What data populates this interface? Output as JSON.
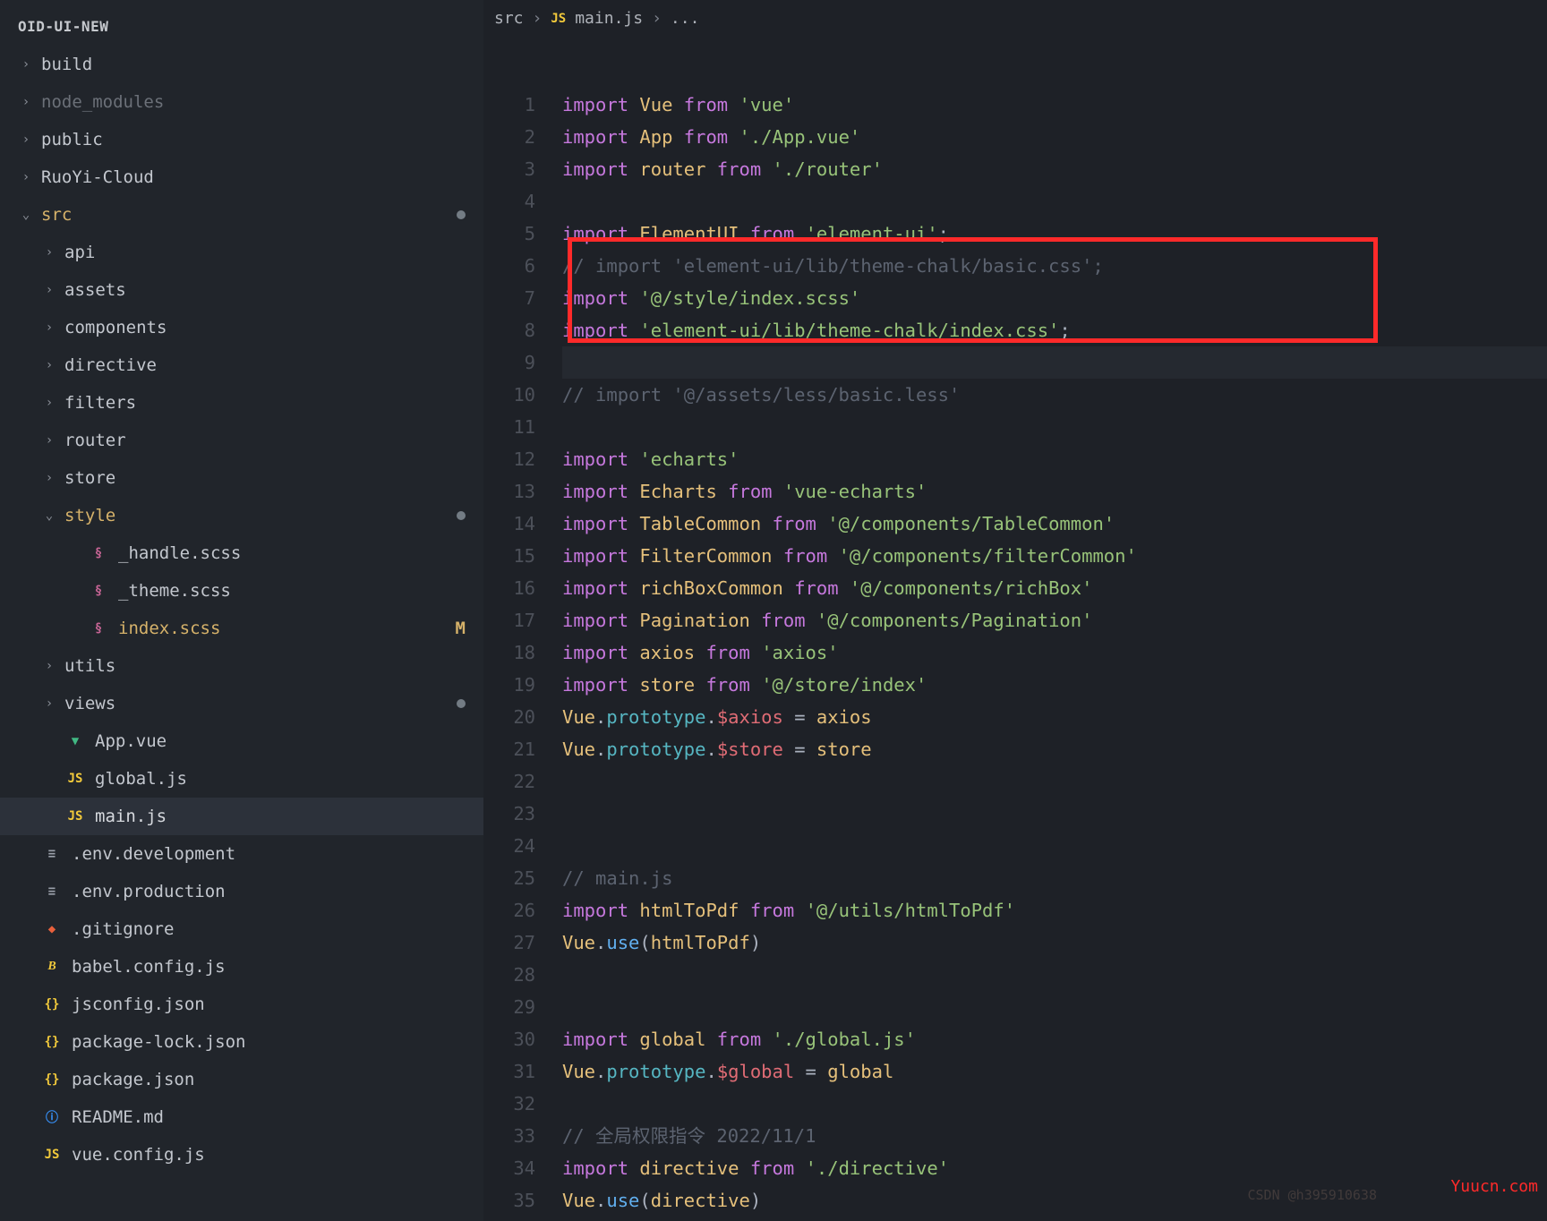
{
  "sidebar": {
    "title": "OID-UI-NEW",
    "items": [
      {
        "label": "build",
        "depth": 1,
        "chev": ">",
        "cls": ""
      },
      {
        "label": "node_modules",
        "depth": 1,
        "chev": ">",
        "cls": "",
        "dim": true
      },
      {
        "label": "public",
        "depth": 1,
        "chev": ">",
        "cls": ""
      },
      {
        "label": "RuoYi-Cloud",
        "depth": 1,
        "chev": ">",
        "cls": ""
      },
      {
        "label": "src",
        "depth": 1,
        "chev": "v",
        "cls": "expanded folder-src",
        "dot": true
      },
      {
        "label": "api",
        "depth": 2,
        "chev": ">",
        "cls": ""
      },
      {
        "label": "assets",
        "depth": 2,
        "chev": ">",
        "cls": ""
      },
      {
        "label": "components",
        "depth": 2,
        "chev": ">",
        "cls": ""
      },
      {
        "label": "directive",
        "depth": 2,
        "chev": ">",
        "cls": ""
      },
      {
        "label": "filters",
        "depth": 2,
        "chev": ">",
        "cls": ""
      },
      {
        "label": "router",
        "depth": 2,
        "chev": ">",
        "cls": ""
      },
      {
        "label": "store",
        "depth": 2,
        "chev": ">",
        "cls": ""
      },
      {
        "label": "style",
        "depth": 2,
        "chev": "v",
        "cls": "style-hl",
        "dot": true
      },
      {
        "label": "_handle.scss",
        "depth": 3,
        "chev": "",
        "cls": "",
        "ico": "scss"
      },
      {
        "label": "_theme.scss",
        "depth": 3,
        "chev": "",
        "cls": "",
        "ico": "scss"
      },
      {
        "label": "index.scss",
        "depth": 3,
        "chev": "",
        "cls": "style-sub",
        "ico": "scss",
        "badge": "M"
      },
      {
        "label": "utils",
        "depth": 2,
        "chev": ">",
        "cls": ""
      },
      {
        "label": "views",
        "depth": 2,
        "chev": ">",
        "cls": "",
        "dot": true
      },
      {
        "label": "App.vue",
        "depth": 2,
        "chev": "",
        "cls": "",
        "ico": "vue"
      },
      {
        "label": "global.js",
        "depth": 2,
        "chev": "",
        "cls": "",
        "ico": "js"
      },
      {
        "label": "main.js",
        "depth": 2,
        "chev": "",
        "cls": "selected",
        "ico": "js"
      },
      {
        "label": ".env.development",
        "depth": 1,
        "chev": "",
        "cls": "",
        "ico": "env"
      },
      {
        "label": ".env.production",
        "depth": 1,
        "chev": "",
        "cls": "",
        "ico": "env"
      },
      {
        "label": ".gitignore",
        "depth": 1,
        "chev": "",
        "cls": "",
        "ico": "git"
      },
      {
        "label": "babel.config.js",
        "depth": 1,
        "chev": "",
        "cls": "",
        "ico": "babel"
      },
      {
        "label": "jsconfig.json",
        "depth": 1,
        "chev": "",
        "cls": "",
        "ico": "json"
      },
      {
        "label": "package-lock.json",
        "depth": 1,
        "chev": "",
        "cls": "",
        "ico": "json"
      },
      {
        "label": "package.json",
        "depth": 1,
        "chev": "",
        "cls": "",
        "ico": "json"
      },
      {
        "label": "README.md",
        "depth": 1,
        "chev": "",
        "cls": "",
        "ico": "info"
      },
      {
        "label": "vue.config.js",
        "depth": 1,
        "chev": "",
        "cls": "",
        "ico": "js"
      }
    ]
  },
  "breadcrumb": {
    "seg1": "src",
    "seg2": "main.js",
    "seg3": "..."
  },
  "code": {
    "lines": [
      {
        "n": 1,
        "tokens": [
          [
            "kw-import",
            "import "
          ],
          [
            "ident-b",
            "Vue"
          ],
          [
            "kw-from",
            " from "
          ],
          [
            "str",
            "'vue'"
          ]
        ]
      },
      {
        "n": 2,
        "tokens": [
          [
            "kw-import",
            "import "
          ],
          [
            "ident-b",
            "App"
          ],
          [
            "kw-from",
            " from "
          ],
          [
            "str",
            "'./App.vue'"
          ]
        ]
      },
      {
        "n": 3,
        "tokens": [
          [
            "kw-import",
            "import "
          ],
          [
            "ident-b",
            "router"
          ],
          [
            "kw-from",
            " from "
          ],
          [
            "str",
            "'./router'"
          ]
        ]
      },
      {
        "n": 4,
        "tokens": []
      },
      {
        "n": 5,
        "tokens": [
          [
            "kw-import",
            "import "
          ],
          [
            "ident-b",
            "ElementUI"
          ],
          [
            "kw-from",
            " from "
          ],
          [
            "str",
            "'element-ui'"
          ],
          [
            "punct",
            ";"
          ]
        ]
      },
      {
        "n": 6,
        "tokens": [
          [
            "cmt",
            "// import 'element-ui/lib/theme-chalk/basic.css';"
          ]
        ]
      },
      {
        "n": 7,
        "tokens": [
          [
            "kw-import",
            "import "
          ],
          [
            "str",
            "'@/style/index.scss'"
          ]
        ]
      },
      {
        "n": 8,
        "tokens": [
          [
            "kw-import",
            "import "
          ],
          [
            "str",
            "'element-ui/lib/theme-chalk/index.css'"
          ],
          [
            "punct",
            ";"
          ]
        ]
      },
      {
        "n": 9,
        "tokens": []
      },
      {
        "n": 10,
        "tokens": [
          [
            "cmt",
            "// import '@/assets/less/basic.less'"
          ]
        ]
      },
      {
        "n": 11,
        "tokens": []
      },
      {
        "n": 12,
        "tokens": [
          [
            "kw-import",
            "import "
          ],
          [
            "str",
            "'echarts'"
          ]
        ]
      },
      {
        "n": 13,
        "tokens": [
          [
            "kw-import",
            "import "
          ],
          [
            "ident-b",
            "Echarts"
          ],
          [
            "kw-from",
            " from "
          ],
          [
            "str",
            "'vue-echarts'"
          ]
        ]
      },
      {
        "n": 14,
        "tokens": [
          [
            "kw-import",
            "import "
          ],
          [
            "ident-b",
            "TableCommon"
          ],
          [
            "kw-from",
            " from "
          ],
          [
            "str",
            "'@/components/TableCommon'"
          ]
        ]
      },
      {
        "n": 15,
        "tokens": [
          [
            "kw-import",
            "import "
          ],
          [
            "ident-b",
            "FilterCommon"
          ],
          [
            "kw-from",
            " from "
          ],
          [
            "str",
            "'@/components/filterCommon'"
          ]
        ]
      },
      {
        "n": 16,
        "tokens": [
          [
            "kw-import",
            "import "
          ],
          [
            "ident-b",
            "richBoxCommon"
          ],
          [
            "kw-from",
            " from "
          ],
          [
            "str",
            "'@/components/richBox'"
          ]
        ]
      },
      {
        "n": 17,
        "tokens": [
          [
            "kw-import",
            "import "
          ],
          [
            "ident-b",
            "Pagination"
          ],
          [
            "kw-from",
            " from "
          ],
          [
            "str",
            "'@/components/Pagination'"
          ]
        ]
      },
      {
        "n": 18,
        "tokens": [
          [
            "kw-import",
            "import "
          ],
          [
            "ident-b",
            "axios"
          ],
          [
            "kw-from",
            " from "
          ],
          [
            "str",
            "'axios'"
          ]
        ]
      },
      {
        "n": 19,
        "tokens": [
          [
            "kw-import",
            "import "
          ],
          [
            "ident-b",
            "store"
          ],
          [
            "kw-from",
            " from "
          ],
          [
            "str",
            "'@/store/index'"
          ]
        ]
      },
      {
        "n": 20,
        "tokens": [
          [
            "var",
            "Vue"
          ],
          [
            "punct",
            "."
          ],
          [
            "member",
            "prototype"
          ],
          [
            "punct",
            "."
          ],
          [
            "ident",
            "$axios"
          ],
          [
            "eq",
            " = "
          ],
          [
            "ident-b",
            "axios"
          ]
        ]
      },
      {
        "n": 21,
        "tokens": [
          [
            "var",
            "Vue"
          ],
          [
            "punct",
            "."
          ],
          [
            "member",
            "prototype"
          ],
          [
            "punct",
            "."
          ],
          [
            "ident",
            "$store"
          ],
          [
            "eq",
            " = "
          ],
          [
            "ident-b",
            "store"
          ]
        ]
      },
      {
        "n": 22,
        "tokens": []
      },
      {
        "n": 23,
        "tokens": []
      },
      {
        "n": 24,
        "tokens": []
      },
      {
        "n": 25,
        "tokens": [
          [
            "cmt",
            "// main.js"
          ]
        ]
      },
      {
        "n": 26,
        "tokens": [
          [
            "kw-import",
            "import "
          ],
          [
            "ident-b",
            "htmlToPdf"
          ],
          [
            "kw-from",
            " from "
          ],
          [
            "str",
            "'@/utils/htmlToPdf'"
          ]
        ]
      },
      {
        "n": 27,
        "tokens": [
          [
            "var",
            "Vue"
          ],
          [
            "punct",
            "."
          ],
          [
            "param",
            "use"
          ],
          [
            "punct",
            "("
          ],
          [
            "ident-b",
            "htmlToPdf"
          ],
          [
            "punct",
            ")"
          ]
        ]
      },
      {
        "n": 28,
        "tokens": []
      },
      {
        "n": 29,
        "tokens": []
      },
      {
        "n": 30,
        "tokens": [
          [
            "kw-import",
            "import "
          ],
          [
            "ident-b",
            "global"
          ],
          [
            "kw-from",
            " from "
          ],
          [
            "str",
            "'./global.js'"
          ]
        ]
      },
      {
        "n": 31,
        "tokens": [
          [
            "var",
            "Vue"
          ],
          [
            "punct",
            "."
          ],
          [
            "member",
            "prototype"
          ],
          [
            "punct",
            "."
          ],
          [
            "ident",
            "$global"
          ],
          [
            "eq",
            " = "
          ],
          [
            "ident-b",
            "global"
          ]
        ]
      },
      {
        "n": 32,
        "tokens": []
      },
      {
        "n": 33,
        "tokens": [
          [
            "cmt",
            "// 全局权限指令 2022/11/1"
          ]
        ]
      },
      {
        "n": 34,
        "tokens": [
          [
            "kw-import",
            "import "
          ],
          [
            "ident-b",
            "directive"
          ],
          [
            "kw-from",
            " from "
          ],
          [
            "str",
            "'./directive'"
          ]
        ]
      },
      {
        "n": 35,
        "tokens": [
          [
            "var",
            "Vue"
          ],
          [
            "punct",
            "."
          ],
          [
            "param",
            "use"
          ],
          [
            "punct",
            "("
          ],
          [
            "ident-b",
            "directive"
          ],
          [
            "punct",
            ")"
          ]
        ]
      }
    ],
    "highlight": {
      "start": 6,
      "end": 8
    },
    "cursor_line": 9
  },
  "watermark1": "CSDN @h395910638",
  "watermark2": "Yuucn.com"
}
